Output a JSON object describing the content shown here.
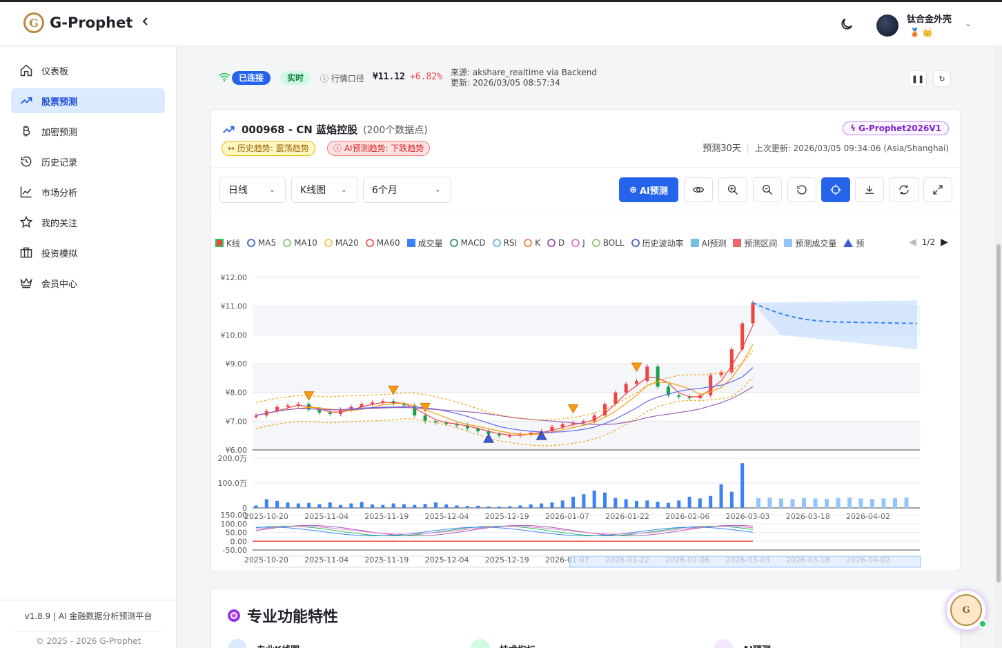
{
  "app": {
    "name": "G-Prophet",
    "logo_letter": "G"
  },
  "user": {
    "name": "钛合金外壳",
    "badges": "🥉 👑"
  },
  "sidebar": {
    "items": [
      {
        "label": "仪表板",
        "icon": "home-icon"
      },
      {
        "label": "股票预测",
        "icon": "trend-up-icon",
        "active": true
      },
      {
        "label": "加密预测",
        "icon": "bitcoin-icon"
      },
      {
        "label": "历史记录",
        "icon": "history-icon"
      },
      {
        "label": "市场分析",
        "icon": "line-chart-icon"
      },
      {
        "label": "我的关注",
        "icon": "star-icon"
      },
      {
        "label": "投资模拟",
        "icon": "briefcase-icon"
      },
      {
        "label": "会员中心",
        "icon": "crown-icon"
      }
    ],
    "version": "v1.8.9 | AI 金融数据分析预测平台",
    "copyright": "© 2025 - 2026 G-Prophet"
  },
  "status": {
    "connected": "已连接",
    "live": "实时",
    "quote_source_label": "行情口径",
    "price": "¥11.12",
    "change_pct": "+6.82%",
    "source": "来源: akshare_realtime via Backend",
    "updated": "更新: 2026/03/05 08:57:34"
  },
  "stock": {
    "title": "000968 - CN 蓝焰控股",
    "count": "(200个数据点)",
    "hist_trend": "历史趋势: 震荡趋势",
    "ai_trend": "AI预测趋势: 下跌趋势",
    "model": "G-Prophet2026V1",
    "pred_days": "预测30天",
    "last_update": "上次更新: 2026/03/05 09:34:06 (Asia/Shanghai)"
  },
  "toolbar": {
    "period": "日线",
    "chart_type": "K线图",
    "range": "6个月",
    "ai_predict": "AI预测"
  },
  "legend": {
    "items": [
      {
        "label": "K线",
        "kind": "box",
        "color": "#ef4444"
      },
      {
        "label": "MA5",
        "kind": "ring",
        "color": "#5470c6"
      },
      {
        "label": "MA10",
        "kind": "ring",
        "color": "#91cc75"
      },
      {
        "label": "MA20",
        "kind": "ring",
        "color": "#fac858"
      },
      {
        "label": "MA60",
        "kind": "ring",
        "color": "#ee6666"
      },
      {
        "label": "成交量",
        "kind": "box",
        "color": "#3b82f6"
      },
      {
        "label": "MACD",
        "kind": "ring",
        "color": "#3ba272"
      },
      {
        "label": "RSI",
        "kind": "ring",
        "color": "#73c0de"
      },
      {
        "label": "K",
        "kind": "ring",
        "color": "#fc8452"
      },
      {
        "label": "D",
        "kind": "ring",
        "color": "#9a60b4"
      },
      {
        "label": "J",
        "kind": "ring",
        "color": "#ea7ccc"
      },
      {
        "label": "BOLL",
        "kind": "ring",
        "color": "#91cc75"
      },
      {
        "label": "历史波动率",
        "kind": "ring",
        "color": "#5470c6"
      },
      {
        "label": "AI预测",
        "kind": "box",
        "color": "#73c0de"
      },
      {
        "label": "预测区间",
        "kind": "box",
        "color": "#ee6666"
      },
      {
        "label": "预测成交量",
        "kind": "box",
        "color": "#93c5fd"
      },
      {
        "label": "预",
        "kind": "tri",
        "color": "#3b5bdb"
      }
    ],
    "page": "1/2"
  },
  "features": {
    "title": "专业功能特性",
    "items": [
      "专业K线图",
      "技术指标",
      "AI预测"
    ]
  },
  "chart_data": {
    "type": "candlestick",
    "x_ticks": [
      "2025-10-20",
      "2025-11-04",
      "2025-11-19",
      "2025-12-04",
      "2025-12-19",
      "2026-01-07",
      "2026-01-22",
      "2026-02-06",
      "2026-03-03",
      "2026-03-18",
      "2026-04-02"
    ],
    "price_axis": {
      "ticks": [
        "¥12.00",
        "¥11.00",
        "¥10.00",
        "¥9.00",
        "¥8.00",
        "¥7.00",
        "¥6.00"
      ],
      "ylim": [
        6,
        12
      ]
    },
    "volume_axis": {
      "ticks": [
        "200.0万",
        "100.0万",
        "0"
      ],
      "ylim": [
        0,
        200
      ]
    },
    "indicator_axis": {
      "ticks": [
        "150.00",
        "100.00",
        "50.00",
        "0.00",
        "-50.00"
      ],
      "ylim": [
        -50,
        150
      ]
    },
    "close_series": [
      7.2,
      7.35,
      7.5,
      7.55,
      7.6,
      7.4,
      7.3,
      7.25,
      7.4,
      7.5,
      7.6,
      7.65,
      7.7,
      7.6,
      7.55,
      7.2,
      7.0,
      6.95,
      6.9,
      6.85,
      6.75,
      6.65,
      6.55,
      6.5,
      6.5,
      6.55,
      6.6,
      6.65,
      6.8,
      6.9,
      6.95,
      7.0,
      7.2,
      7.6,
      8.0,
      8.3,
      8.4,
      8.9,
      8.2,
      7.9,
      7.85,
      7.8,
      7.9,
      8.6,
      8.7,
      9.5,
      10.4,
      11.12
    ],
    "forecast": {
      "start": 11.12,
      "end": 10.4,
      "band_high": 11.2,
      "band_low": 9.5
    },
    "volume_series": [
      10,
      35,
      28,
      22,
      18,
      20,
      15,
      22,
      12,
      18,
      24,
      14,
      12,
      18,
      15,
      12,
      16,
      22,
      14,
      10,
      8,
      9,
      6,
      5,
      7,
      10,
      14,
      18,
      22,
      30,
      45,
      55,
      70,
      62,
      40,
      35,
      28,
      30,
      25,
      20,
      30,
      45,
      38,
      48,
      95,
      65,
      180
    ],
    "forecast_volume": [
      40,
      42,
      38,
      35,
      40,
      38,
      36,
      40,
      42,
      38,
      36,
      38,
      40,
      42
    ]
  }
}
